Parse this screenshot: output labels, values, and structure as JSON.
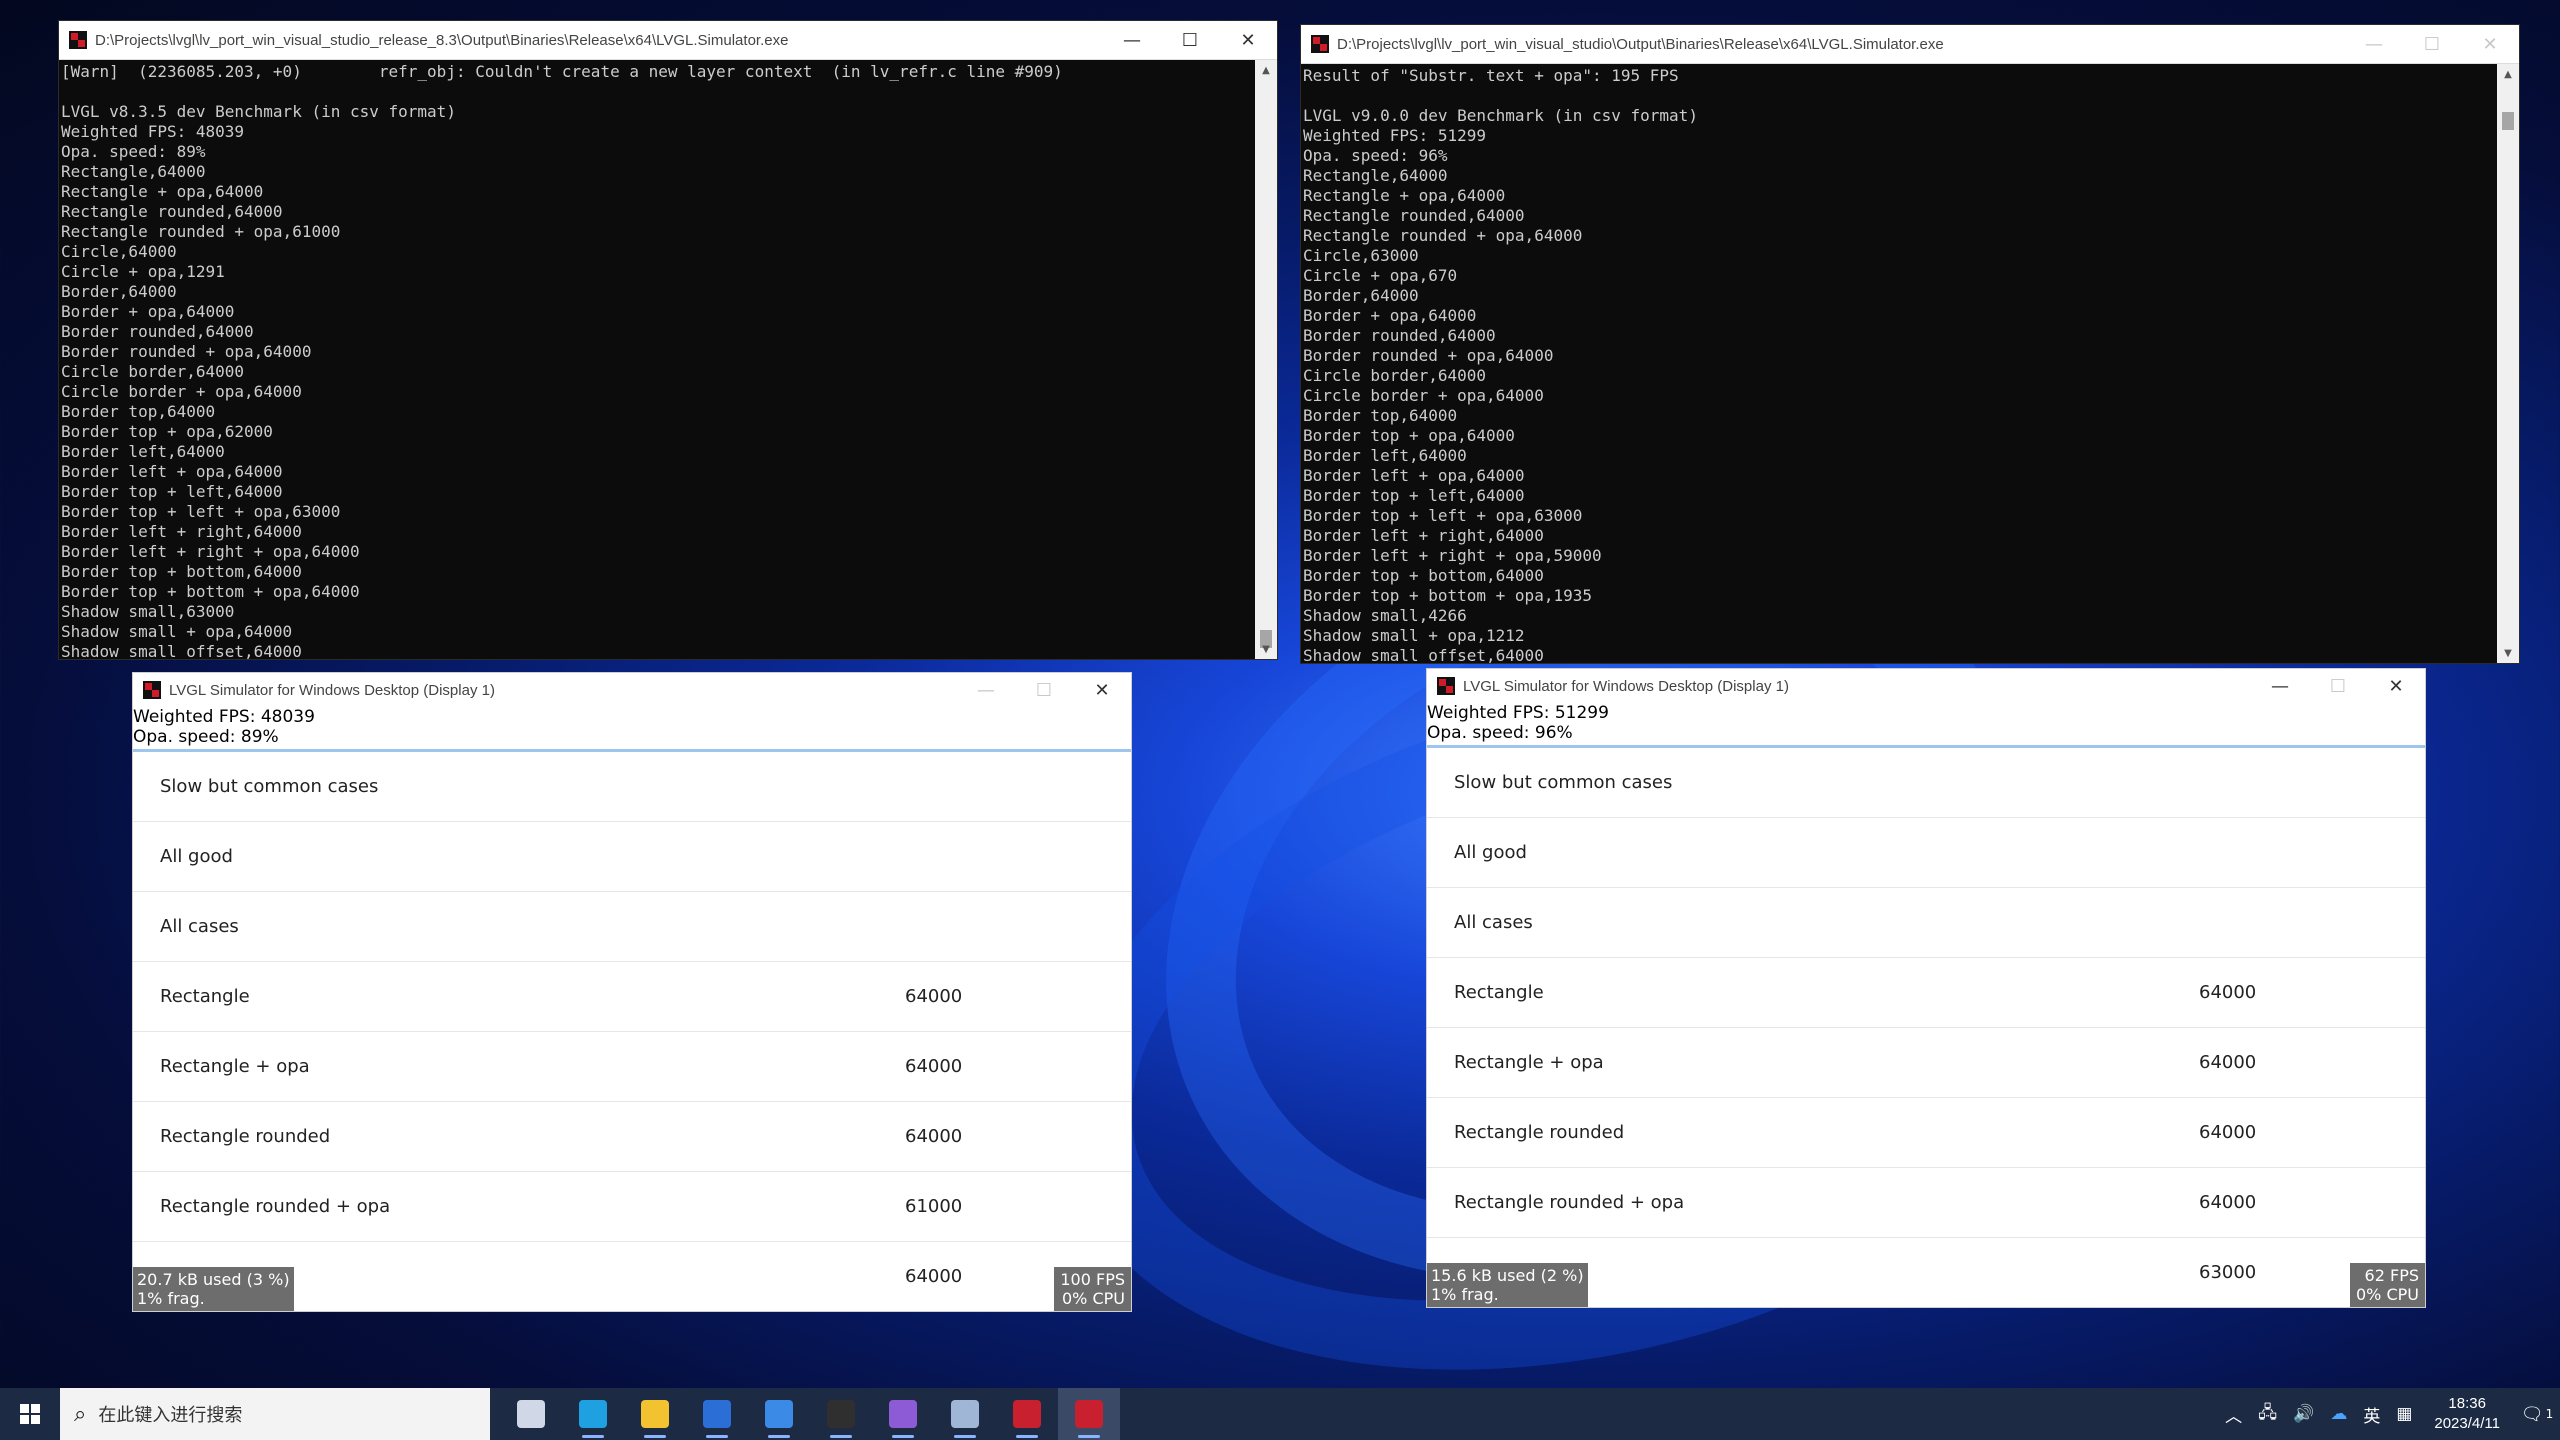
{
  "console_left": {
    "title": "D:\\Projects\\lvgl\\lv_port_win_visual_studio_release_8.3\\Output\\Binaries\\Release\\x64\\LVGL.Simulator.exe",
    "lines": [
      "[Warn]  (2236085.203, +0)        refr_obj: Couldn't create a new layer context  (in lv_refr.c line #909)",
      "",
      "LVGL v8.3.5 dev Benchmark (in csv format)",
      "Weighted FPS: 48039",
      "Opa. speed: 89%",
      "Rectangle,64000",
      "Rectangle + opa,64000",
      "Rectangle rounded,64000",
      "Rectangle rounded + opa,61000",
      "Circle,64000",
      "Circle + opa,1291",
      "Border,64000",
      "Border + opa,64000",
      "Border rounded,64000",
      "Border rounded + opa,64000",
      "Circle border,64000",
      "Circle border + opa,64000",
      "Border top,64000",
      "Border top + opa,62000",
      "Border left,64000",
      "Border left + opa,64000",
      "Border top + left,64000",
      "Border top + left + opa,63000",
      "Border left + right,64000",
      "Border left + right + opa,64000",
      "Border top + bottom,64000",
      "Border top + bottom + opa,64000",
      "Shadow small,63000",
      "Shadow small + opa,64000",
      "Shadow small offset,64000"
    ]
  },
  "console_right": {
    "title": "D:\\Projects\\lvgl\\lv_port_win_visual_studio\\Output\\Binaries\\Release\\x64\\LVGL.Simulator.exe",
    "lines": [
      "Result of \"Substr. text + opa\": 195 FPS",
      "",
      "LVGL v9.0.0 dev Benchmark (in csv format)",
      "Weighted FPS: 51299",
      "Opa. speed: 96%",
      "Rectangle,64000",
      "Rectangle + opa,64000",
      "Rectangle rounded,64000",
      "Rectangle rounded + opa,64000",
      "Circle,63000",
      "Circle + opa,670",
      "Border,64000",
      "Border + opa,64000",
      "Border rounded,64000",
      "Border rounded + opa,64000",
      "Circle border,64000",
      "Circle border + opa,64000",
      "Border top,64000",
      "Border top + opa,64000",
      "Border left,64000",
      "Border left + opa,64000",
      "Border top + left,64000",
      "Border top + left + opa,63000",
      "Border left + right,64000",
      "Border left + right + opa,59000",
      "Border top + bottom,64000",
      "Border top + bottom + opa,1935",
      "Shadow small,4266",
      "Shadow small + opa,1212",
      "Shadow small offset,64000"
    ]
  },
  "sim_left": {
    "title": "LVGL Simulator for Windows Desktop (Display 1)",
    "fps_line": "Weighted FPS: 48039",
    "opa_line": "Opa. speed: 89%",
    "rows": [
      {
        "label": "Slow but common cases",
        "value": ""
      },
      {
        "label": "All good",
        "value": ""
      },
      {
        "label": "All cases",
        "value": ""
      },
      {
        "label": "Rectangle",
        "value": "64000"
      },
      {
        "label": "Rectangle + opa",
        "value": "64000"
      },
      {
        "label": "Rectangle rounded",
        "value": "64000"
      },
      {
        "label": "Rectangle rounded + opa",
        "value": "61000"
      },
      {
        "label": "",
        "value": "64000"
      }
    ],
    "mem_line1": "20.7 kB used (3 %)",
    "mem_line2": "1% frag.",
    "perf_line1": "100 FPS",
    "perf_line2": "0% CPU"
  },
  "sim_right": {
    "title": "LVGL Simulator for Windows Desktop (Display 1)",
    "fps_line": "Weighted FPS: 51299",
    "opa_line": "Opa. speed: 96%",
    "rows": [
      {
        "label": "Slow but common cases",
        "value": ""
      },
      {
        "label": "All good",
        "value": ""
      },
      {
        "label": "All cases",
        "value": ""
      },
      {
        "label": "Rectangle",
        "value": "64000"
      },
      {
        "label": "Rectangle + opa",
        "value": "64000"
      },
      {
        "label": "Rectangle rounded",
        "value": "64000"
      },
      {
        "label": "Rectangle rounded + opa",
        "value": "64000"
      },
      {
        "label": "",
        "value": "63000"
      }
    ],
    "mem_line1": "15.6 kB used (2 %)",
    "mem_line2": "1% frag.",
    "perf_line1": "62 FPS",
    "perf_line2": "0% CPU"
  },
  "window_buttons": {
    "minimize": "—",
    "maximize": "☐",
    "close": "✕"
  },
  "taskbar": {
    "search_placeholder": "在此键入进行搜索",
    "apps": [
      {
        "name": "task-view-icon",
        "color": "#d0d8e8"
      },
      {
        "name": "edge-icon",
        "color": "#1fa0e0"
      },
      {
        "name": "file-explorer-icon",
        "color": "#f2c230"
      },
      {
        "name": "outlook-icon",
        "color": "#2b6fd6"
      },
      {
        "name": "mail-icon",
        "color": "#3b8be6"
      },
      {
        "name": "terminal-icon",
        "color": "#2f2f2f"
      },
      {
        "name": "visual-studio-icon",
        "color": "#8d5bd6"
      },
      {
        "name": "remote-desktop-icon",
        "color": "#9fb6d6"
      },
      {
        "name": "lvgl-sim-icon-1",
        "color": "#c8202e"
      },
      {
        "name": "lvgl-sim-icon-2",
        "color": "#c8202e"
      }
    ],
    "ime_label": "英",
    "time": "18:36",
    "date": "2023/4/11",
    "notification_count": "1"
  }
}
